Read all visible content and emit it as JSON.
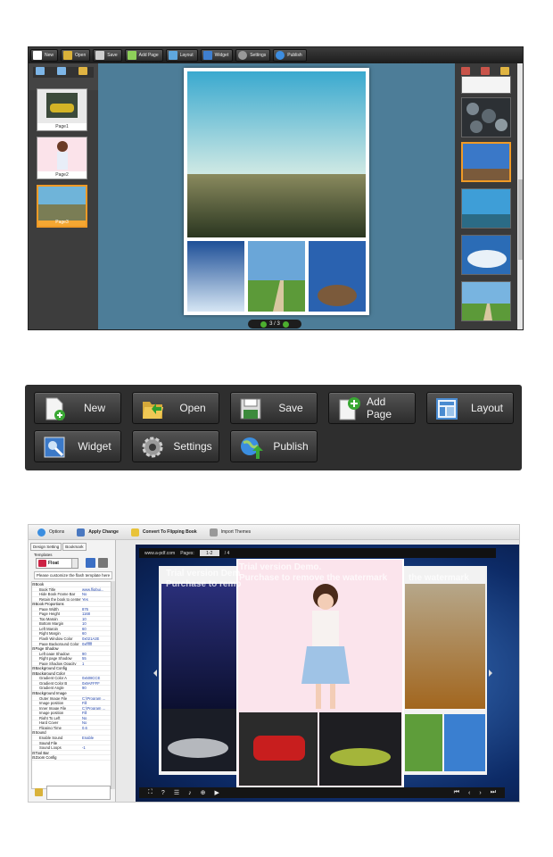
{
  "editor": {
    "toolbar": [
      "New",
      "Open",
      "Save",
      "Add Page",
      "Layout",
      "Widget",
      "Settings",
      "Publish"
    ],
    "pages": [
      "Page1",
      "Page2",
      "Page3"
    ],
    "nav_text": "3 / 3"
  },
  "toolbar_zoom": {
    "buttons": [
      "New",
      "Open",
      "Save",
      "Add Page",
      "Layout",
      "Widget",
      "Settings",
      "Publish"
    ]
  },
  "settings_app": {
    "menu": [
      "Options",
      "Apply Change",
      "Convert To Flipping Book",
      "Import Themes"
    ],
    "tabs": [
      "Design Setting",
      "Bookmark"
    ],
    "templates_label": "Templates",
    "template_value": "Float",
    "customize_hint": "Please customize the flash template here",
    "properties": [
      [
        "⊟Book",
        ""
      ],
      [
        "Book Title",
        "www.flipbui..."
      ],
      [
        "Hide Book Frame Bar",
        "No"
      ],
      [
        "Retain the book to center",
        "Yes"
      ],
      [
        "⊟Book Proportions",
        ""
      ],
      [
        "Page Width",
        "876"
      ],
      [
        "Page Height",
        "1168"
      ],
      [
        "Top Margin",
        "10"
      ],
      [
        "Bottom Margin",
        "10"
      ],
      [
        "Left Margin",
        "60"
      ],
      [
        "Right Margin",
        "60"
      ],
      [
        "Flash Window Color",
        "0x021A2E"
      ],
      [
        "Page Background Color",
        "0xffffff"
      ],
      [
        "⊟Page Shadow",
        ""
      ],
      [
        "Left page Shadow",
        "90"
      ],
      [
        "Right page Shadow",
        "55"
      ],
      [
        "Page Shadow Opacity",
        "1"
      ],
      [
        "⊟Background Config",
        ""
      ],
      [
        "⊟Background Color",
        ""
      ],
      [
        "Gradient Color A",
        "0x508CCE"
      ],
      [
        "Gradient Color B",
        "0x9AFFFF"
      ],
      [
        "Gradient Angle",
        "90"
      ],
      [
        "⊟Background Image",
        ""
      ],
      [
        "Outer Image File",
        "C:\\Program ..."
      ],
      [
        "Image position",
        "Fill"
      ],
      [
        "Inner Image File",
        "C:\\Program ..."
      ],
      [
        "Image position",
        "Fill"
      ],
      [
        "Right To Left",
        "No"
      ],
      [
        "Hard Cover",
        "No"
      ],
      [
        "Flipping Time",
        "0.6"
      ],
      [
        "⊟Sound",
        ""
      ],
      [
        "Enable Sound",
        "Enable"
      ],
      [
        "Sound File",
        ""
      ],
      [
        "Sound Loops",
        "-1"
      ],
      [
        "⊟Tool Bar",
        ""
      ],
      [
        "⊟Zoom Config",
        ""
      ]
    ],
    "viewer": {
      "url": "www.a-pdf.com",
      "pages_label": "Pages:",
      "page_box": "1-2",
      "page_total": "/ 4",
      "watermark_1": "Trial version Demo.",
      "watermark_2": "Purchase to remove the watermark",
      "watermark_left_1": "Trial version Dem",
      "watermark_left_2": "Purchase to remo",
      "watermark_right": "the watermark"
    }
  }
}
